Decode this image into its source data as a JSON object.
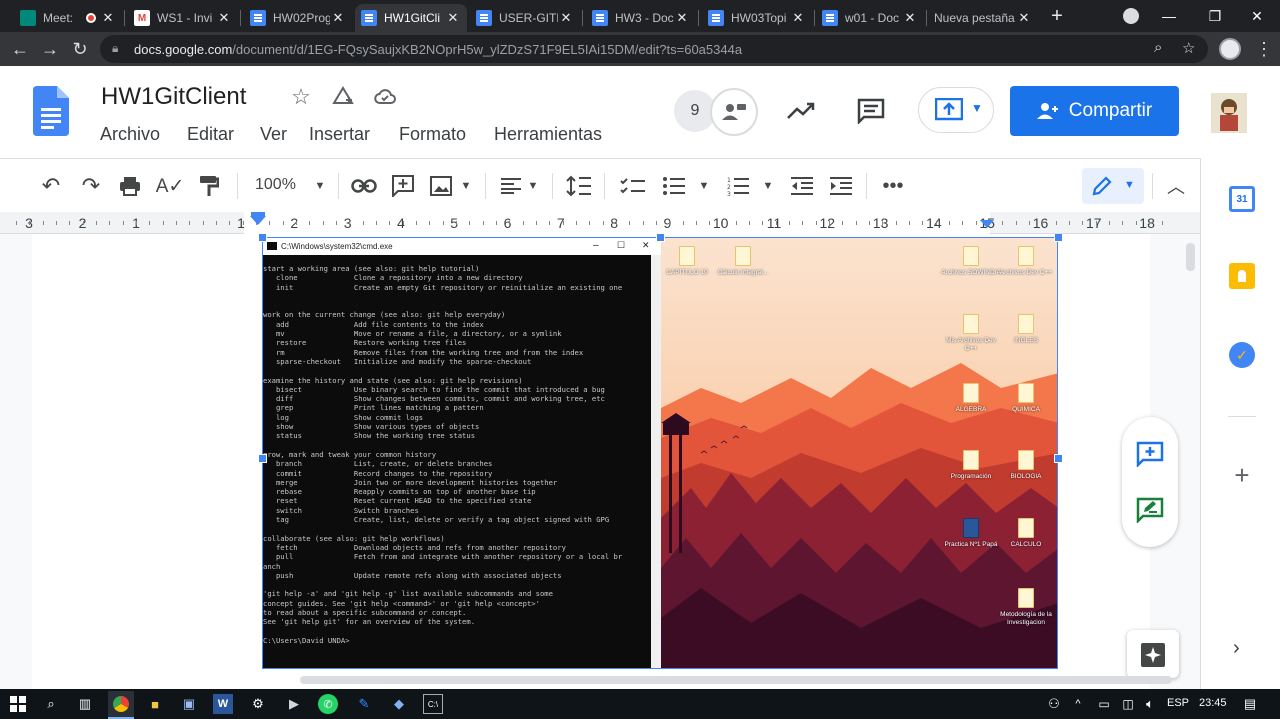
{
  "browser": {
    "tabs": [
      {
        "title": "Meet:",
        "favicon": "meet-icon",
        "active": false
      },
      {
        "title": "WS1 - Invi",
        "favicon": "gmail-icon",
        "active": false
      },
      {
        "title": "HW02Prog",
        "favicon": "docs-icon",
        "active": false
      },
      {
        "title": "HW1GitCli",
        "favicon": "docs-icon",
        "active": true
      },
      {
        "title": "USER-GITH",
        "favicon": "docs-icon",
        "active": false
      },
      {
        "title": "HW3 - Doc",
        "favicon": "docs-icon",
        "active": false
      },
      {
        "title": "HW03Topi",
        "favicon": "docs-icon",
        "active": false
      },
      {
        "title": "w01 - Doc",
        "favicon": "docs-icon",
        "active": false
      },
      {
        "title": "Nueva pestaña",
        "favicon": "",
        "active": false
      }
    ],
    "new_tab_symbol": "+",
    "url_host": "docs.google.com",
    "url_path": "/document/d/1EG-FQsySaujxKB2NOprH5w_ylZDzS71F9EL5IAi15DM/edit?ts=60a5344a"
  },
  "docs": {
    "title": "HW1GitClient",
    "menu": [
      "Archivo",
      "Editar",
      "Ver",
      "Insertar",
      "Formato",
      "Herramientas"
    ],
    "viewers_count": "9",
    "share_label": "Compartir",
    "zoom": "100%",
    "ruler_numbers": [
      "3",
      "2",
      "1",
      "1",
      "2",
      "3",
      "4",
      "5",
      "6",
      "7",
      "8",
      "9",
      "10",
      "11",
      "12",
      "13",
      "14",
      "15",
      "16",
      "17",
      "18"
    ]
  },
  "cmd": {
    "window_title": "C:\\Windows\\system32\\cmd.exe",
    "lines": [
      "start a working area (see also: git help tutorial)",
      "   clone             Clone a repository into a new directory",
      "   init              Create an empty Git repository or reinitialize an existing one",
      "",
      "",
      "work on the current change (see also: git help everyday)",
      "   add               Add file contents to the index",
      "   mv                Move or rename a file, a directory, or a symlink",
      "   restore           Restore working tree files",
      "   rm                Remove files from the working tree and from the index",
      "   sparse-checkout   Initialize and modify the sparse-checkout",
      "",
      "examine the history and state (see also: git help revisions)",
      "   bisect            Use binary search to find the commit that introduced a bug",
      "   diff              Show changes between commits, commit and working tree, etc",
      "   grep              Print lines matching a pattern",
      "   log               Show commit logs",
      "   show              Show various types of objects",
      "   status            Show the working tree status",
      "",
      "grow, mark and tweak your common history",
      "   branch            List, create, or delete branches",
      "   commit            Record changes to the repository",
      "   merge             Join two or more development histories together",
      "   rebase            Reapply commits on top of another base tip",
      "   reset             Reset current HEAD to the specified state",
      "   switch            Switch branches",
      "   tag               Create, list, delete or verify a tag object signed with GPG",
      "",
      "collaborate (see also: git help workflows)",
      "   fetch             Download objects and refs from another repository",
      "   pull              Fetch from and integrate with another repository or a local br",
      "anch",
      "   push              Update remote refs along with associated objects",
      "",
      "'git help -a' and 'git help -g' list available subcommands and some",
      "concept guides. See 'git help <command>' or 'git help <concept>'",
      "to read about a specific subcommand or concept.",
      "See 'git help git' for an overview of the system.",
      "",
      "C:\\Users\\David UNDA>"
    ]
  },
  "desktop": {
    "icons": [
      {
        "label": "CAPITULO 10"
      },
      {
        "label": "Cálculo Integral..."
      },
      {
        "label": "Archivos SOWINDIA"
      },
      {
        "label": "Archivos Dev C++"
      },
      {
        "label": "Mis Archivos Dev C++"
      },
      {
        "label": "INGLES"
      },
      {
        "label": "ALGEBRA"
      },
      {
        "label": "QUIMICA"
      },
      {
        "label": "Programación"
      },
      {
        "label": "BIOLOGIA"
      },
      {
        "label": "Practica Nº1 Papá"
      },
      {
        "label": "CALCULO"
      },
      {
        "label": "Metodología de la Investigacion"
      }
    ]
  },
  "taskbar": {
    "language": "ESP",
    "time": "23:45"
  },
  "colors": {
    "chrome_dark": "#202124",
    "docs_blue": "#1a73e8",
    "cmd_bg": "#0c0c0c",
    "wallpaper_sky": "#f9d7b8",
    "wallpaper_mountain": "#e8573a",
    "wallpaper_forest": "#5a1530"
  }
}
